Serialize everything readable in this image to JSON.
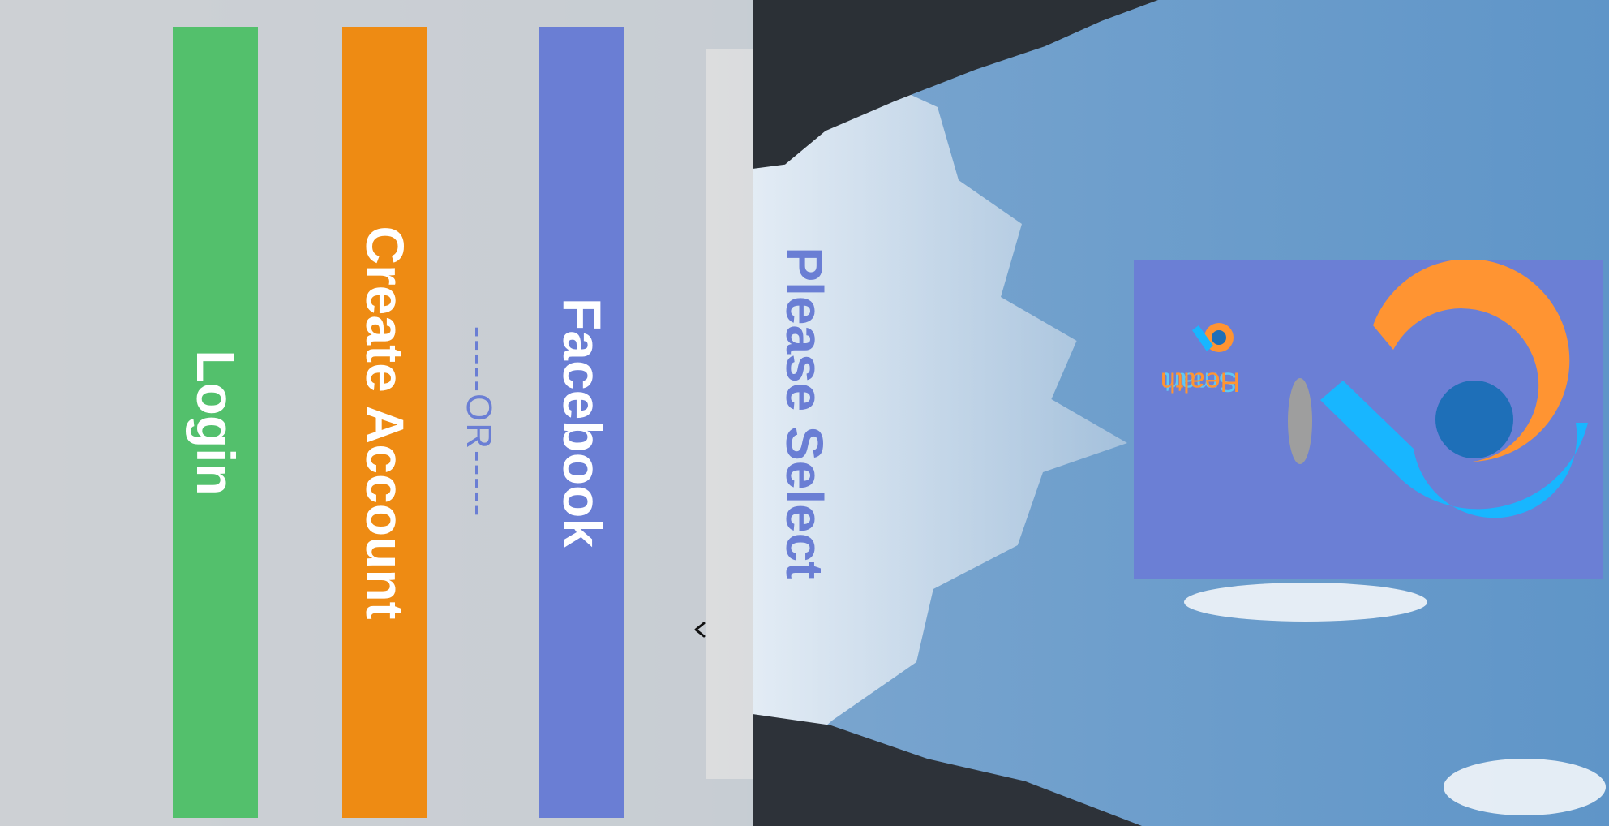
{
  "colors": {
    "facebook": "#6a7ed4",
    "create_account": "#ee8b13",
    "login": "#53c06c",
    "accent_blue": "#6a7ed4",
    "logo_card": "#6b7fd5",
    "logo_orange": "#ff9432",
    "logo_cyan": "#18b6ff",
    "logo_dark_blue": "#1e6fb8",
    "brand_smart": "#5ec8f5",
    "brand_health": "#ff9432"
  },
  "header": {
    "title": "Please Select",
    "back_icon": "chevron-left-icon"
  },
  "buttons": {
    "facebook_label": "Facebook",
    "create_account_label": "Create Account",
    "login_label": "Login"
  },
  "divider": {
    "text": "-----OR-----"
  },
  "brand": {
    "name_part1": "Smart",
    "name_part2": "Health"
  }
}
